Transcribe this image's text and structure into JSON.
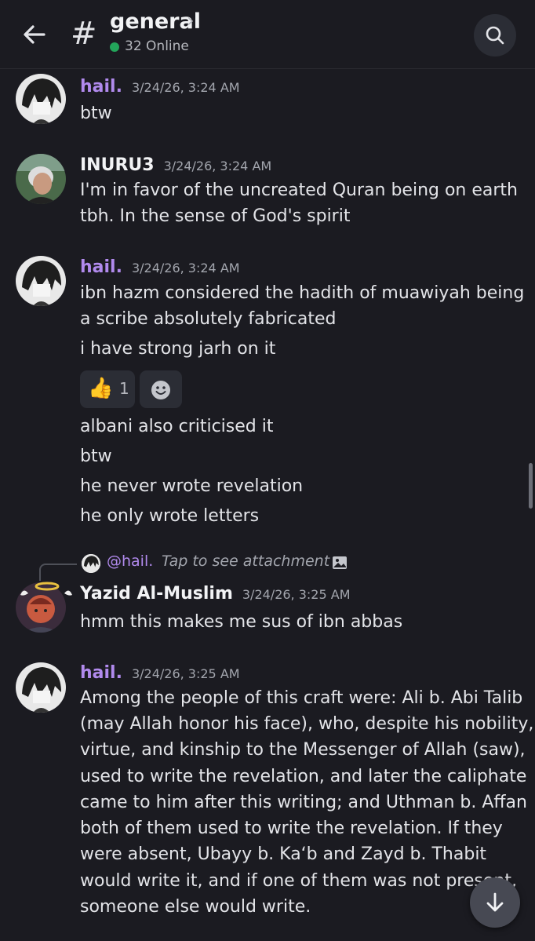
{
  "header": {
    "channel_name": "general",
    "online_text": "32 Online"
  },
  "messages": [
    {
      "author": "hail.",
      "timestamp": "3/24/26, 3:24 AM",
      "lines": [
        "btw"
      ]
    },
    {
      "author": "INURU3",
      "timestamp": "3/24/26, 3:24 AM",
      "lines": [
        "I'm in favor of the uncreated Quran being on earth",
        "tbh. In the sense of God's spirit"
      ]
    },
    {
      "author": "hail.",
      "timestamp": "3/24/26, 3:24 AM",
      "lines": [
        "ibn hazm considered the hadith of muawiyah being",
        "a scribe absolutely fabricated",
        "i have strong jarh on it"
      ],
      "reaction": {
        "emoji": "👍",
        "count": "1"
      },
      "followups": [
        "albani also criticised it",
        "btw",
        "he never wrote revelation",
        "he only wrote letters"
      ]
    },
    {
      "reply": {
        "author": "@hail.",
        "text": "Tap to see attachment"
      },
      "author": "Yazid Al-Muslim",
      "timestamp": "3/24/26, 3:25 AM",
      "lines": [
        "hmm this makes me sus of ibn abbas"
      ]
    },
    {
      "author": "hail.",
      "timestamp": "3/24/26, 3:25 AM",
      "lines": [
        "Among the people of this craft were: Ali b. Abi Talib",
        "(may Allah honor his face), who, despite his nobility,",
        "virtue, and kinship to the Messenger of Allah (saw),",
        "used to write the revelation, and later the caliphate",
        "came to him after this writing; and Uthman b. Affan",
        "both of them used to write the revelation. If they",
        "were absent, Ubayy b. Ka‘b and Zayd b. Thabit",
        "would write it, and if one of them was not present,",
        "someone else would write."
      ]
    }
  ],
  "colors": {
    "accent_purple": "#b18aed",
    "online_green": "#23a55a",
    "background": "#1b1b21"
  },
  "icons": {
    "back": "arrow-left-icon",
    "hash": "hash-icon",
    "search": "search-icon",
    "add_reaction": "smiley-icon",
    "image": "image-icon",
    "scroll_down": "arrow-down-icon"
  }
}
